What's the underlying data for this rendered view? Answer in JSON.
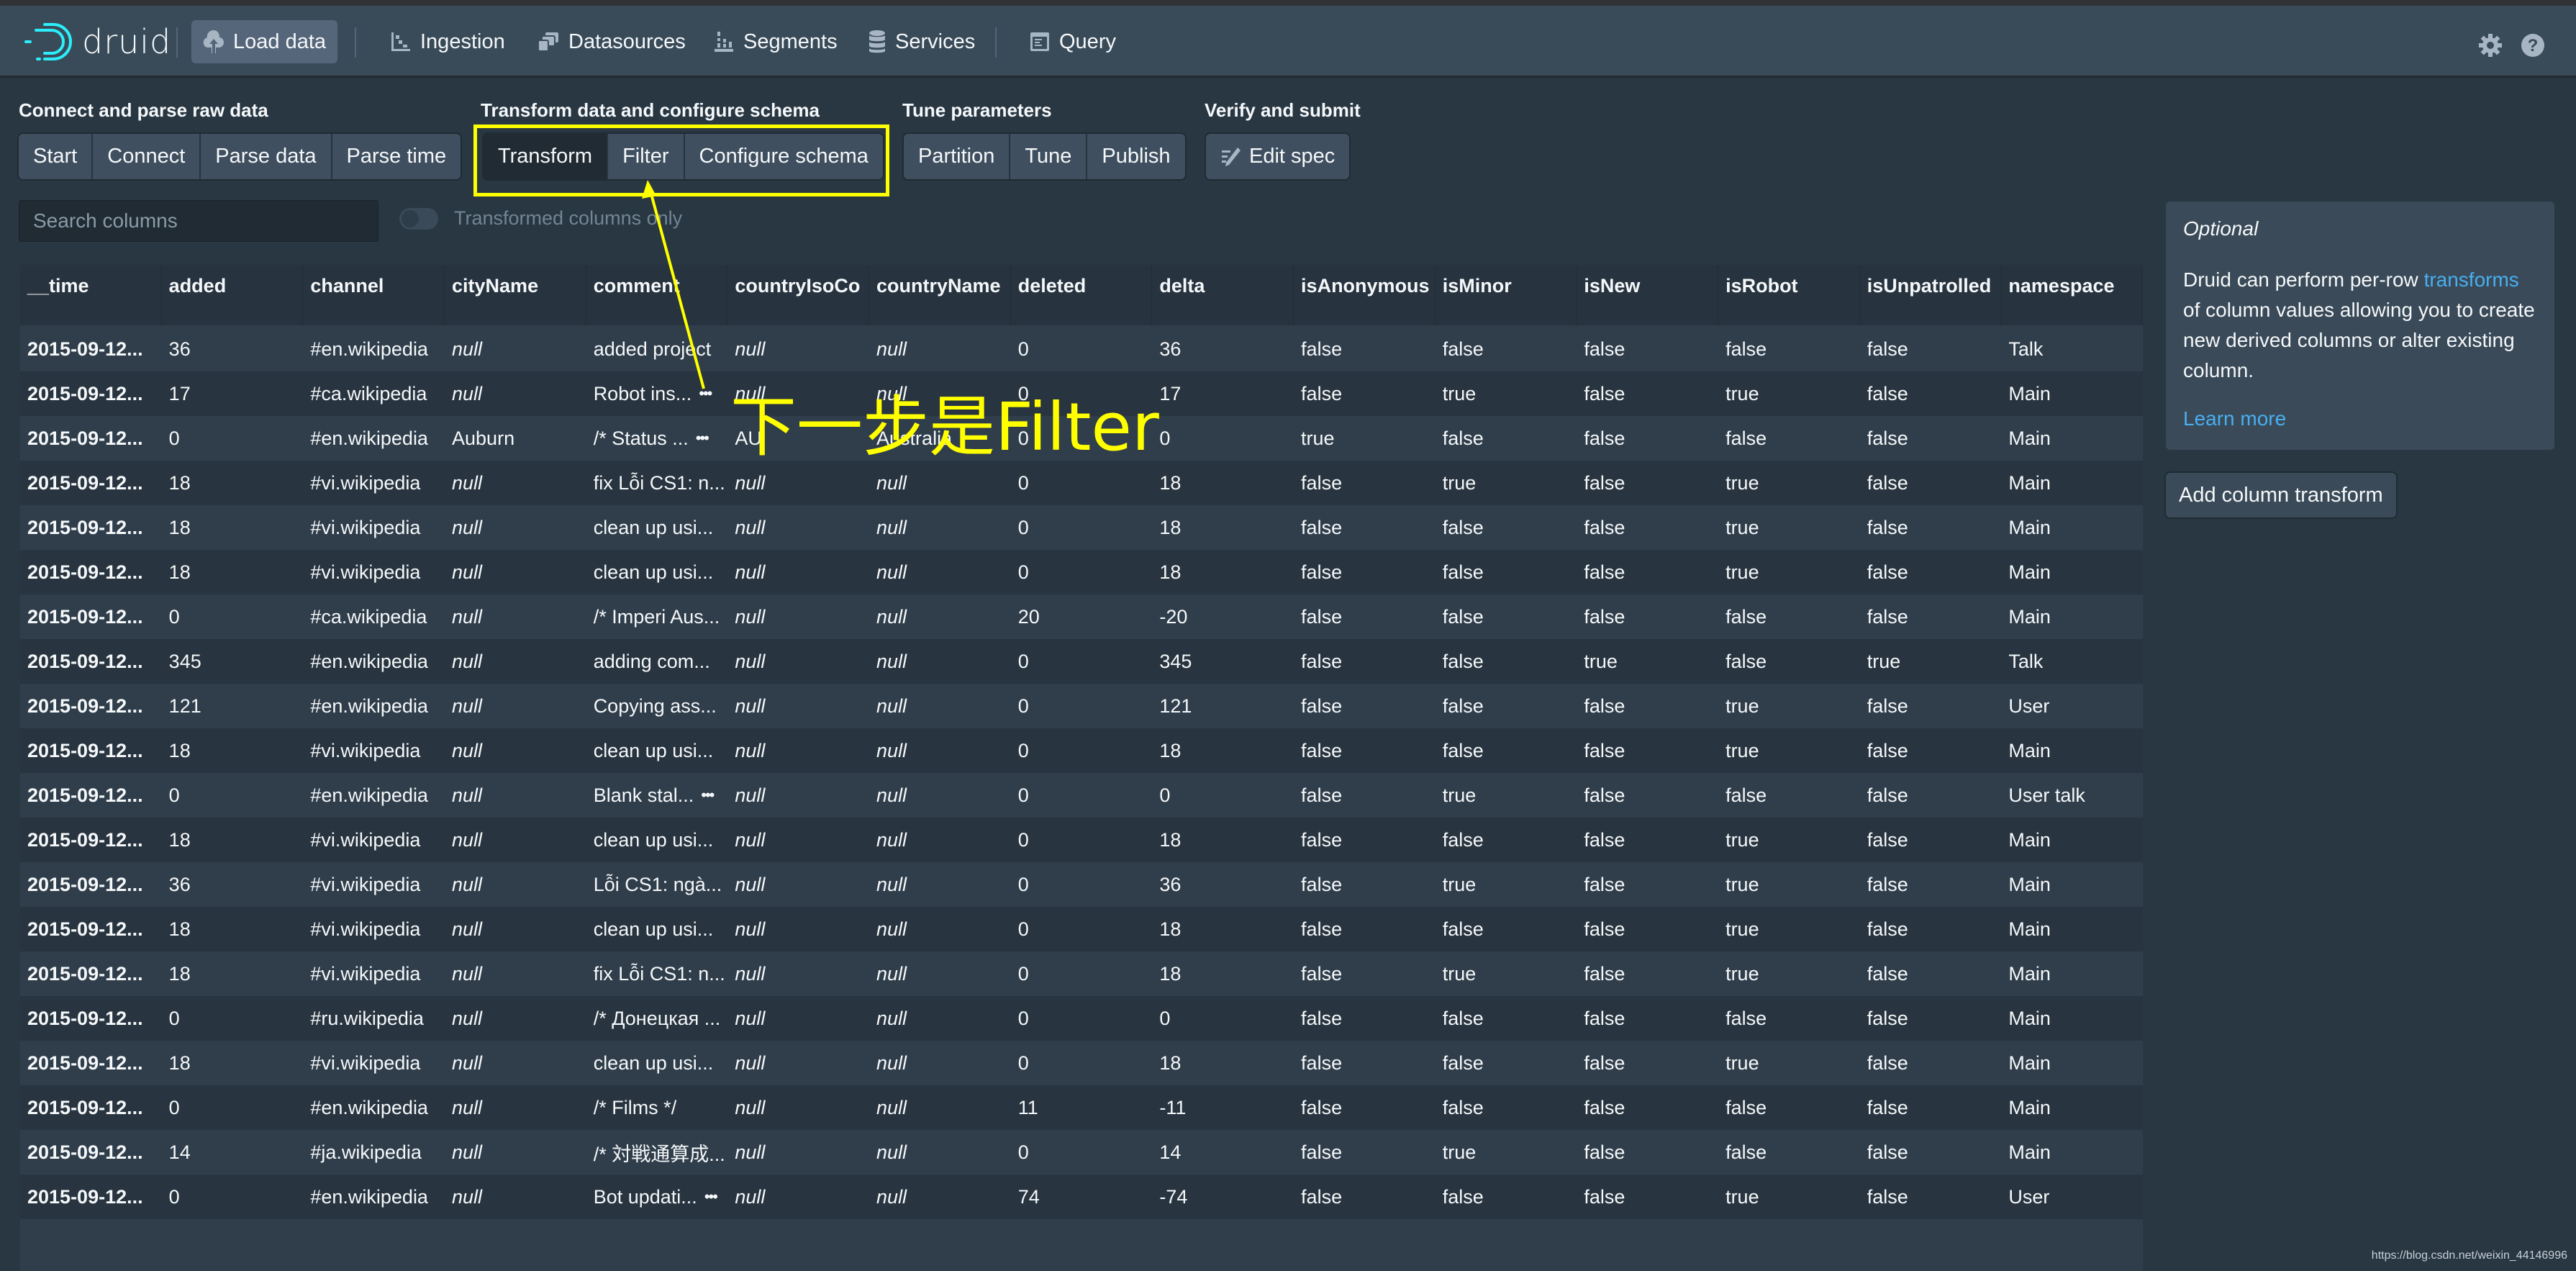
{
  "app": {
    "name": "druid"
  },
  "nav": {
    "items": [
      {
        "label": "Load data",
        "icon": "cloud-upload-icon",
        "active": true
      },
      {
        "label": "Ingestion",
        "icon": "gantt-chart-icon"
      },
      {
        "label": "Datasources",
        "icon": "multi-select-icon"
      },
      {
        "label": "Segments",
        "icon": "stacked-chart-icon"
      },
      {
        "label": "Services",
        "icon": "database-icon"
      },
      {
        "label": "Query",
        "icon": "application-icon"
      }
    ],
    "right_icons": [
      "gear-icon",
      "help-icon"
    ]
  },
  "steps": {
    "groups": [
      {
        "heading": "Connect and parse raw data",
        "buttons": [
          "Start",
          "Connect",
          "Parse data",
          "Parse time"
        ]
      },
      {
        "heading": "Transform data and configure schema",
        "buttons": [
          "Transform",
          "Filter",
          "Configure schema"
        ],
        "active": "Transform"
      },
      {
        "heading": "Tune parameters",
        "buttons": [
          "Partition",
          "Tune",
          "Publish"
        ]
      },
      {
        "heading": "Verify and submit",
        "buttons": [
          "Edit spec"
        ]
      }
    ]
  },
  "search": {
    "placeholder": "Search columns",
    "value": ""
  },
  "toggle": {
    "label": "Transformed columns only",
    "checked": false
  },
  "table": {
    "columns": [
      "__time",
      "added",
      "channel",
      "cityName",
      "comment",
      "countryIsoCode",
      "countryName",
      "deleted",
      "delta",
      "isAnonymous",
      "isMinor",
      "isNew",
      "isRobot",
      "isUnpatrolled",
      "namespace"
    ],
    "column_display": [
      "__time",
      "added",
      "channel",
      "cityName",
      "comment",
      "countryIsoCo",
      "countryName",
      "deleted",
      "delta",
      "isAnonymous",
      "isMinor",
      "isNew",
      "isRobot",
      "isUnpatrolled",
      "namespace"
    ],
    "rows": [
      [
        "2015-09-12...",
        "36",
        "#en.wikipedia",
        "null",
        "added project",
        "null",
        "null",
        "0",
        "36",
        "false",
        "false",
        "false",
        "false",
        "false",
        "Talk"
      ],
      [
        "2015-09-12...",
        "17",
        "#ca.wikipedia",
        "null",
        "Robot ins...",
        "null",
        "null",
        "0",
        "17",
        "false",
        "true",
        "false",
        "true",
        "false",
        "Main"
      ],
      [
        "2015-09-12...",
        "0",
        "#en.wikipedia",
        "Auburn",
        "/* Status ...",
        "AU",
        "Australia",
        "0",
        "0",
        "true",
        "false",
        "false",
        "false",
        "false",
        "Main"
      ],
      [
        "2015-09-12...",
        "18",
        "#vi.wikipedia",
        "null",
        "fix Lỗi CS1: n...",
        "null",
        "null",
        "0",
        "18",
        "false",
        "true",
        "false",
        "true",
        "false",
        "Main"
      ],
      [
        "2015-09-12...",
        "18",
        "#vi.wikipedia",
        "null",
        "clean up usi...",
        "null",
        "null",
        "0",
        "18",
        "false",
        "false",
        "false",
        "true",
        "false",
        "Main"
      ],
      [
        "2015-09-12...",
        "18",
        "#vi.wikipedia",
        "null",
        "clean up usi...",
        "null",
        "null",
        "0",
        "18",
        "false",
        "false",
        "false",
        "true",
        "false",
        "Main"
      ],
      [
        "2015-09-12...",
        "0",
        "#ca.wikipedia",
        "null",
        "/* Imperi Aus...",
        "null",
        "null",
        "20",
        "-20",
        "false",
        "false",
        "false",
        "false",
        "false",
        "Main"
      ],
      [
        "2015-09-12...",
        "345",
        "#en.wikipedia",
        "null",
        "adding com...",
        "null",
        "null",
        "0",
        "345",
        "false",
        "false",
        "true",
        "false",
        "true",
        "Talk"
      ],
      [
        "2015-09-12...",
        "121",
        "#en.wikipedia",
        "null",
        "Copying ass...",
        "null",
        "null",
        "0",
        "121",
        "false",
        "false",
        "false",
        "true",
        "false",
        "User"
      ],
      [
        "2015-09-12...",
        "18",
        "#vi.wikipedia",
        "null",
        "clean up usi...",
        "null",
        "null",
        "0",
        "18",
        "false",
        "false",
        "false",
        "true",
        "false",
        "Main"
      ],
      [
        "2015-09-12...",
        "0",
        "#en.wikipedia",
        "null",
        "Blank stal...",
        "null",
        "null",
        "0",
        "0",
        "false",
        "true",
        "false",
        "false",
        "false",
        "User talk"
      ],
      [
        "2015-09-12...",
        "18",
        "#vi.wikipedia",
        "null",
        "clean up usi...",
        "null",
        "null",
        "0",
        "18",
        "false",
        "false",
        "false",
        "true",
        "false",
        "Main"
      ],
      [
        "2015-09-12...",
        "36",
        "#vi.wikipedia",
        "null",
        "Lỗi CS1: ngà...",
        "null",
        "null",
        "0",
        "36",
        "false",
        "true",
        "false",
        "true",
        "false",
        "Main"
      ],
      [
        "2015-09-12...",
        "18",
        "#vi.wikipedia",
        "null",
        "clean up usi...",
        "null",
        "null",
        "0",
        "18",
        "false",
        "false",
        "false",
        "true",
        "false",
        "Main"
      ],
      [
        "2015-09-12...",
        "18",
        "#vi.wikipedia",
        "null",
        "fix Lỗi CS1: n...",
        "null",
        "null",
        "0",
        "18",
        "false",
        "true",
        "false",
        "true",
        "false",
        "Main"
      ],
      [
        "2015-09-12...",
        "0",
        "#ru.wikipedia",
        "null",
        "/* Донецкая ...",
        "null",
        "null",
        "0",
        "0",
        "false",
        "false",
        "false",
        "false",
        "false",
        "Main"
      ],
      [
        "2015-09-12...",
        "18",
        "#vi.wikipedia",
        "null",
        "clean up usi...",
        "null",
        "null",
        "0",
        "18",
        "false",
        "false",
        "false",
        "true",
        "false",
        "Main"
      ],
      [
        "2015-09-12...",
        "0",
        "#en.wikipedia",
        "null",
        "/* Films */",
        "null",
        "null",
        "11",
        "-11",
        "false",
        "false",
        "false",
        "false",
        "false",
        "Main"
      ],
      [
        "2015-09-12...",
        "14",
        "#ja.wikipedia",
        "null",
        "/* 対戦通算成...",
        "null",
        "null",
        "0",
        "14",
        "false",
        "true",
        "false",
        "false",
        "false",
        "Main"
      ],
      [
        "2015-09-12...",
        "0",
        "#en.wikipedia",
        "null",
        "Bot updati...",
        "null",
        "null",
        "74",
        "-74",
        "false",
        "false",
        "false",
        "true",
        "false",
        "User"
      ]
    ],
    "comment_more_rows": [
      1,
      2,
      10,
      19
    ]
  },
  "side_panel": {
    "heading": "Optional",
    "text_before_link": "Druid can perform per-row ",
    "link_text": "transforms",
    "text_after_link": " of column values allowing you to create new derived columns or alter existing column.",
    "learn_more": "Learn more",
    "add_button": "Add column transform"
  },
  "annotation": {
    "text": "下一步是Filter",
    "color": "#ffff00"
  },
  "watermark": "https://blog.csdn.net/weixin_44146996",
  "colors": {
    "background": "#293742",
    "navbar": "#394b59",
    "link": "#48aff0",
    "logo_accent": "#2ceefb"
  }
}
